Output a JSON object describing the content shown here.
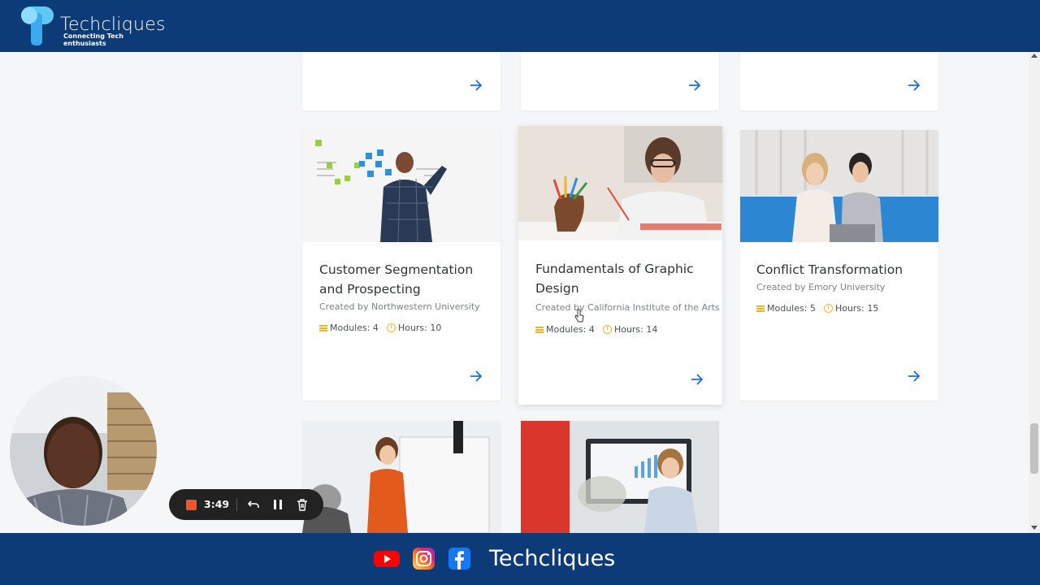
{
  "header": {
    "brand": "Techcliques",
    "tagline": "Connecting Tech enthusiasts"
  },
  "courses": [
    {
      "title": "Customer Segmentation and Prospecting",
      "creator": "Created by Northwestern University",
      "modules": "Modules: 4",
      "hours": "Hours: 10"
    },
    {
      "title": "Fundamentals of Graphic Design",
      "creator": "Created by California Institute of the Arts",
      "modules": "Modules: 4",
      "hours": "Hours: 14"
    },
    {
      "title": "Conflict Transformation",
      "creator": "Created by Emory University",
      "modules": "Modules: 5",
      "hours": "Hours: 15"
    }
  ],
  "recorder": {
    "time": "3:49"
  },
  "footer": {
    "brand": "Techcliques",
    "social": [
      "youtube-icon",
      "instagram-icon",
      "facebook-icon"
    ]
  },
  "colors": {
    "banner": "#0d3b78",
    "accent": "#1a6fd6",
    "meta_icon": "#f0b429",
    "record": "#f2552c"
  }
}
